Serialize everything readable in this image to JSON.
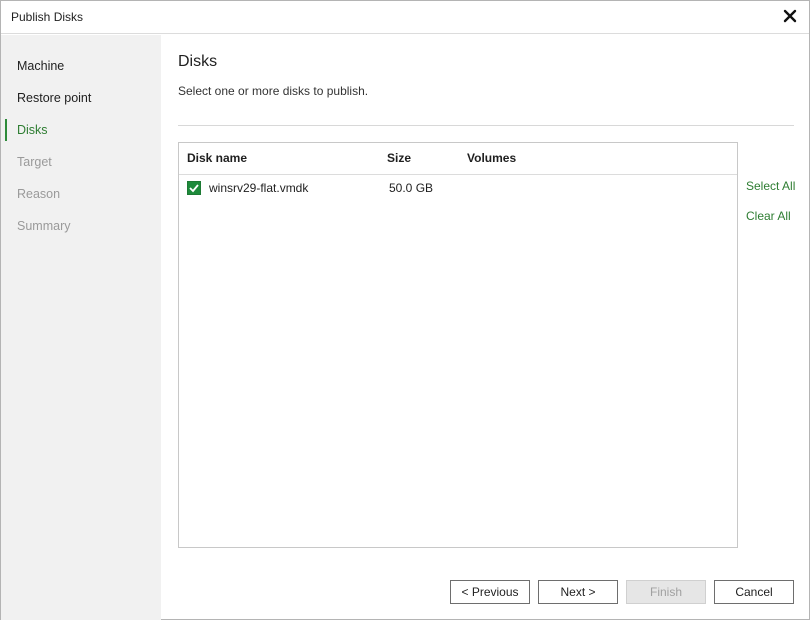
{
  "window": {
    "title": "Publish Disks",
    "close_icon": "close-icon"
  },
  "sidebar": {
    "items": [
      {
        "label": "Machine",
        "state": "completed"
      },
      {
        "label": "Restore point",
        "state": "completed"
      },
      {
        "label": "Disks",
        "state": "active"
      },
      {
        "label": "Target",
        "state": "disabled"
      },
      {
        "label": "Reason",
        "state": "disabled"
      },
      {
        "label": "Summary",
        "state": "disabled"
      }
    ]
  },
  "main": {
    "title": "Disks",
    "subtitle": "Select one or more disks to publish."
  },
  "table": {
    "columns": [
      "Disk name",
      "Size",
      "Volumes"
    ],
    "rows": [
      {
        "checked": true,
        "disk_name": "winsrv29-flat.vmdk",
        "size": "50.0 GB",
        "volumes": ""
      }
    ]
  },
  "actions": {
    "select_all": "Select All",
    "clear_all": "Clear All"
  },
  "buttons": {
    "previous": "< Previous",
    "next": "Next >",
    "finish": "Finish",
    "cancel": "Cancel"
  },
  "colors": {
    "accent": "#2e7d32",
    "checkbox": "#1d8a3b",
    "sidebar_bg": "#f1f1f1"
  }
}
